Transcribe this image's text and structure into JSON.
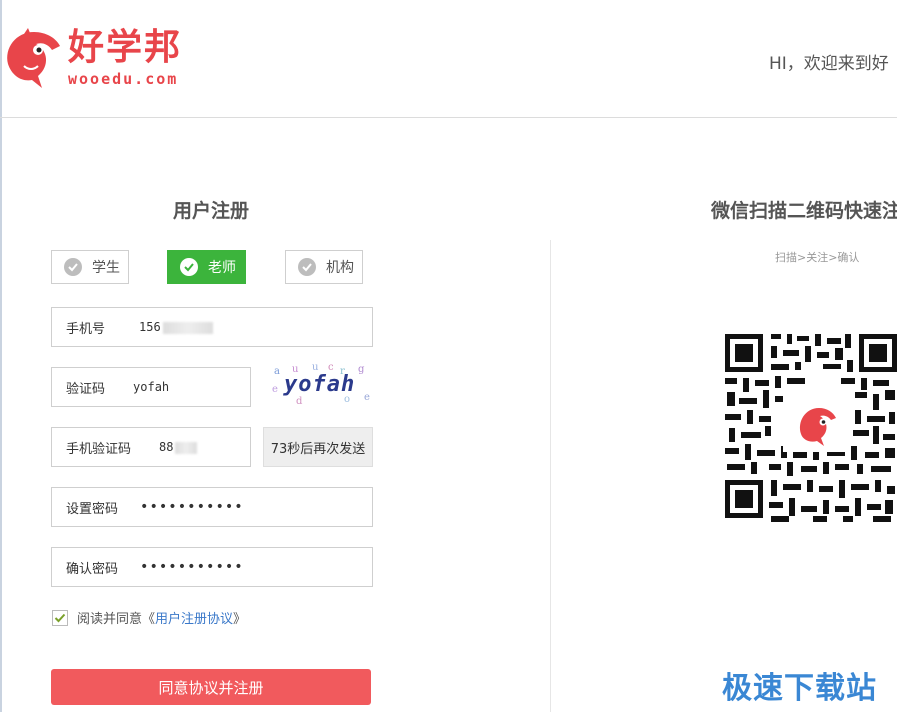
{
  "brand": {
    "name": "好学邦",
    "domain": "wooedu.com",
    "color": "#e8454a"
  },
  "header": {
    "greeting": "HI，欢迎来到好"
  },
  "register": {
    "title": "用户注册",
    "roles": [
      {
        "label": "学生",
        "active": false
      },
      {
        "label": "老师",
        "active": true
      },
      {
        "label": "机构",
        "active": false
      }
    ],
    "phone": {
      "label": "手机号",
      "value": "156"
    },
    "captcha": {
      "label": "验证码",
      "value": "yofah",
      "image_text": "yofah"
    },
    "sms_code": {
      "label": "手机验证码",
      "value": "88"
    },
    "resend_label": "73秒后再次发送",
    "password": {
      "label": "设置密码",
      "masked": "•••••••••••"
    },
    "confirm_password": {
      "label": "确认密码",
      "masked": "•••••••••••"
    },
    "agreement": {
      "checked": true,
      "prefix": "阅读并同意",
      "open_quote": "《",
      "link": "用户注册协议",
      "close_quote": "》"
    },
    "submit_label": "同意协议并注册",
    "accent_color": "#f15a5d",
    "active_role_color": "#3cb43c"
  },
  "qr_panel": {
    "title": "微信扫描二维码快速注",
    "steps": "扫描>关注>确认"
  },
  "watermark": {
    "text": "极速下载站",
    "color": "#3a87d4"
  },
  "icons": {
    "role_check": "check-circle-icon",
    "agree_check": "checkmark-icon",
    "logo": "dolphin-logo-icon"
  }
}
